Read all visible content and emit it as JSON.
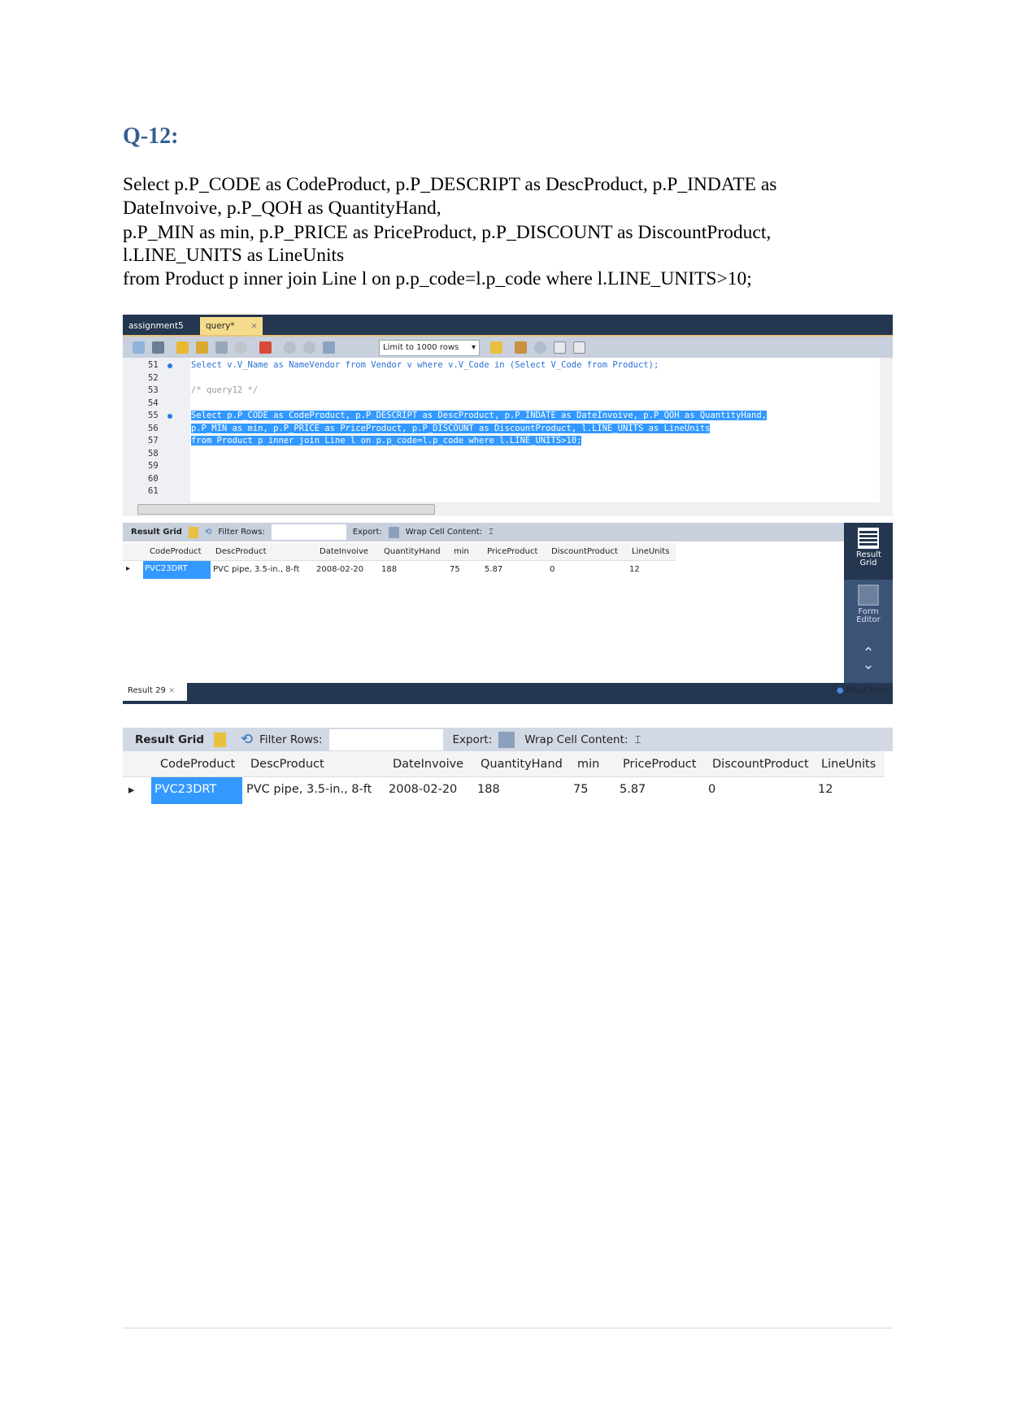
{
  "heading": "Q-12:",
  "paragraph": [
    "Select p.P_CODE as CodeProduct, p.P_DESCRIPT as DescProduct, p.P_INDATE as",
    "DateInvoive, p.P_QOH as QuantityHand,",
    "p.P_MIN as min, p.P_PRICE as PriceProduct, p.P_DISCOUNT as DiscountProduct,",
    "l.LINE_UNITS as LineUnits",
    "from Product p inner join Line l on p.p_code=l.p_code where l.LINE_UNITS>10;"
  ],
  "workbench": {
    "tabs": [
      "assignment5",
      "query*"
    ],
    "limit_select": "Limit to 1000 rows",
    "line_numbers": [
      "51",
      "52",
      "53",
      "54",
      "55",
      "56",
      "57",
      "58",
      "59",
      "60",
      "61"
    ],
    "code": {
      "l51": "Select v.V_Name as NameVendor from Vendor v where v.V_Code in (Select V_Code from Product);",
      "l53": "/* query12 */",
      "l55": "Select p.P_CODE as CodeProduct, p.P_DESCRIPT as DescProduct, p.P_INDATE as DateInvoive, p.P_QOH as QuantityHand,",
      "l56": "p.P_MIN as min, p.P_PRICE as PriceProduct, p.P_DISCOUNT as DiscountProduct, l.LINE_UNITS as LineUnits",
      "l57": "from Product p inner join Line l on p.p_code=l.p_code where l.LINE_UNITS>10;"
    },
    "result_toolbar": {
      "result_grid": "Result Grid",
      "filter_rows": "Filter Rows:",
      "export": "Export:",
      "wrap": "Wrap Cell Content:"
    },
    "side_panel": {
      "result_grid": "Result Grid",
      "form_editor": "Form Editor"
    },
    "result_tab": "Result 29",
    "status": "Read Only"
  },
  "table": {
    "columns": [
      "CodeProduct",
      "DescProduct",
      "DateInvoive",
      "QuantityHand",
      "min",
      "PriceProduct",
      "DiscountProduct",
      "LineUnits"
    ],
    "rows": [
      [
        "PVC23DRT",
        "PVC pipe, 3.5-in., 8-ft",
        "2008-02-20",
        "188",
        "75",
        "5.87",
        "0",
        "12"
      ]
    ]
  },
  "colors": {
    "heading": "#365f91",
    "selection": "#3399ff",
    "dark_bar": "#243650",
    "toolbar": "#c8d0dd"
  }
}
